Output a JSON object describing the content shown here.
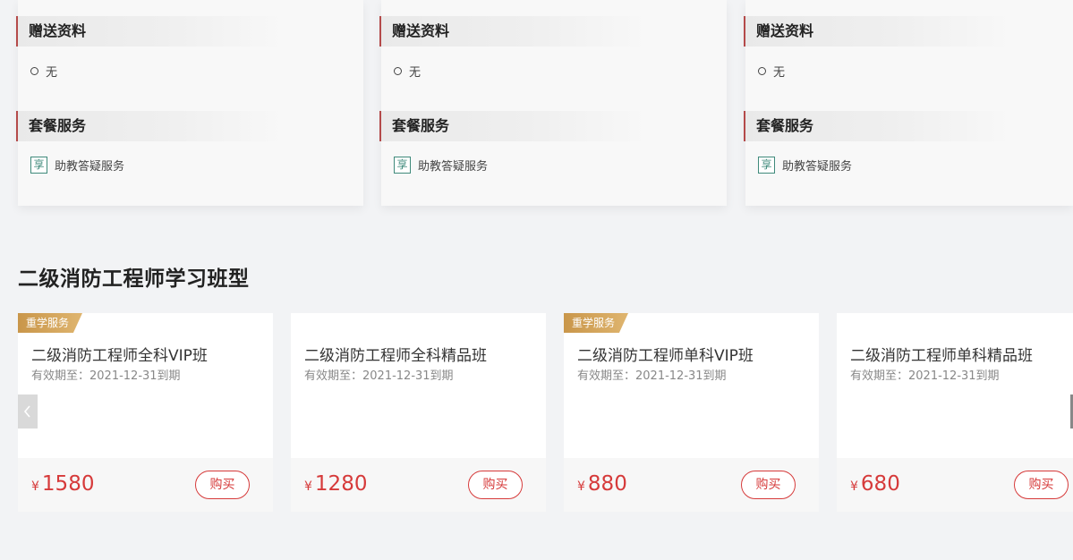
{
  "packages": [
    {
      "gift_title": "赠送资料",
      "gift_item": "无",
      "service_title": "套餐服务",
      "service_icon_char": "享",
      "service_item": "助教答疑服务"
    },
    {
      "gift_title": "赠送资料",
      "gift_item": "无",
      "service_title": "套餐服务",
      "service_icon_char": "享",
      "service_item": "助教答疑服务"
    },
    {
      "gift_title": "赠送资料",
      "gift_item": "无",
      "service_title": "套餐服务",
      "service_icon_char": "享",
      "service_item": "助教答疑服务"
    }
  ],
  "section": {
    "title": "二级消防工程师学习班型"
  },
  "classes": [
    {
      "badge": "重学服务",
      "name": "二级消防工程师全科VIP班",
      "valid": "有效期至：2021-12-31到期",
      "currency": "¥",
      "price": "1580",
      "buy_label": "购买"
    },
    {
      "badge": "",
      "name": "二级消防工程师全科精品班",
      "valid": "有效期至：2021-12-31到期",
      "currency": "¥",
      "price": "1280",
      "buy_label": "购买"
    },
    {
      "badge": "重学服务",
      "name": "二级消防工程师单科VIP班",
      "valid": "有效期至：2021-12-31到期",
      "currency": "¥",
      "price": "880",
      "buy_label": "购买"
    },
    {
      "badge": "",
      "name": "二级消防工程师单科精品班",
      "valid": "有效期至：2021-12-31到期",
      "currency": "¥",
      "price": "680",
      "buy_label": "购买"
    }
  ],
  "colors": {
    "accent_red": "#d63a3a",
    "badge_gold": "#c9964a",
    "section_bar": "#b44a4a",
    "enjoy_green": "#3f8a7b"
  },
  "icons": {
    "carousel_prev": "chevron-left-icon",
    "carousel_next": "chevron-right-icon"
  }
}
